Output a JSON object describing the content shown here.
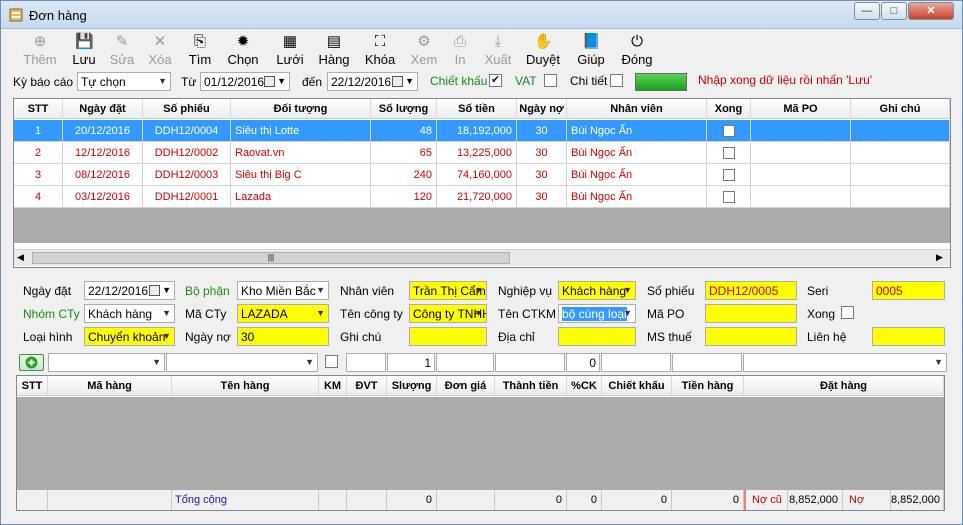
{
  "window": {
    "title": "Đơn hàng",
    "min": "—",
    "max": "□",
    "close": "✕"
  },
  "toolbar": [
    {
      "label": "Thêm",
      "icon": "add-icon",
      "glyph": "⊕",
      "disabled": true
    },
    {
      "label": "Lưu",
      "icon": "save-icon",
      "glyph": "💾",
      "disabled": false
    },
    {
      "label": "Sửa",
      "icon": "edit-icon",
      "glyph": "✎",
      "disabled": true
    },
    {
      "label": "Xóa",
      "icon": "delete-icon",
      "glyph": "✕",
      "disabled": true
    },
    {
      "label": "Tìm",
      "icon": "find-icon",
      "glyph": "⎘",
      "disabled": false
    },
    {
      "label": "Chọn",
      "icon": "select-icon",
      "glyph": "✹",
      "disabled": false
    },
    {
      "label": "Lưới",
      "icon": "grid-icon",
      "glyph": "▦",
      "disabled": false
    },
    {
      "label": "Hàng",
      "icon": "goods-icon",
      "glyph": "▤",
      "disabled": false
    },
    {
      "label": "Khóa",
      "icon": "lock-icon",
      "glyph": "⛶",
      "disabled": false
    },
    {
      "label": "Xem",
      "icon": "view-icon",
      "glyph": "⚙",
      "disabled": true
    },
    {
      "label": "In",
      "icon": "print-icon",
      "glyph": "⎙",
      "disabled": true
    },
    {
      "label": "Xuất",
      "icon": "export-icon",
      "glyph": "⤓",
      "disabled": true
    },
    {
      "label": "Duyệt",
      "icon": "approve-icon",
      "glyph": "✋",
      "disabled": false
    },
    {
      "label": "Giúp",
      "icon": "help-icon",
      "glyph": "📘",
      "disabled": false
    },
    {
      "label": "Đóng",
      "icon": "power-icon",
      "glyph": "⏻",
      "disabled": false
    }
  ],
  "filter": {
    "period_label": "Kỳ báo cáo",
    "period_value": "Tự chọn",
    "from_label": "Từ",
    "from_value": "01/12/2016",
    "to_label": "đến",
    "to_value": "22/12/2016",
    "discount_label": "Chiết khấu",
    "discount_checked": "✔",
    "vat_label": "VAT",
    "detail_label": "Chi tiết",
    "message": "Nhập xong dữ liệu rồi nhấn 'Lưu'"
  },
  "orders": {
    "columns": [
      "STT",
      "Ngày đặt",
      "Số phiếu",
      "Đối tượng",
      "Số lượng",
      "Số tiền",
      "Ngày nợ",
      "Nhân viên",
      "Xong",
      "Mã PO",
      "Ghi chú"
    ],
    "rows": [
      {
        "stt": "1",
        "date": "20/12/2016",
        "code": "DDH12/0004",
        "customer": "Siêu thị Lotte",
        "qty": "48",
        "amount": "18,192,000",
        "days": "30",
        "staff": "Bùi Ngọc Ấn"
      },
      {
        "stt": "2",
        "date": "12/12/2016",
        "code": "DDH12/0002",
        "customer": "Raovat.vn",
        "qty": "65",
        "amount": "13,225,000",
        "days": "30",
        "staff": "Bùi Ngọc Ấn"
      },
      {
        "stt": "3",
        "date": "08/12/2016",
        "code": "DDH12/0003",
        "customer": "Siêu thị Big C",
        "qty": "240",
        "amount": "74,160,000",
        "days": "30",
        "staff": "Bùi Ngọc Ấn"
      },
      {
        "stt": "4",
        "date": "03/12/2016",
        "code": "DDH12/0001",
        "customer": "Lazada",
        "qty": "120",
        "amount": "21,720,000",
        "days": "30",
        "staff": "Bùi Ngọc Ấn"
      }
    ],
    "scroll_grip": "|||"
  },
  "form": {
    "order_date_label": "Ngày đặt",
    "order_date": "22/12/2016",
    "dept_label": "Bộ phận",
    "dept": "Kho Miền Bắc",
    "staff_label": "Nhân viên",
    "staff": "Trần Thị Cẩm",
    "op_label": "Nghiệp vụ",
    "op": "Khách hàng",
    "voucher_label": "Số phiếu",
    "voucher": "DDH12/0005",
    "seri_label": "Seri",
    "seri": "0005",
    "group_label": "Nhóm CTy",
    "group": "Khách hàng",
    "code_label": "Mã CTy",
    "code": "LAZADA",
    "company_label": "Tên công ty",
    "company": "Công ty TNHH",
    "promo_label": "Tên CTKM",
    "promo": "bộ cùng loại",
    "po_label": "Mã PO",
    "done_label": "Xong",
    "type_label": "Loại hình",
    "type": "Chuyển khoản",
    "debt_label": "Ngày nợ",
    "debt": "30",
    "note_label": "Ghi chú",
    "addr_label": "Địa chỉ",
    "tax_label": "MS thuế",
    "contact_label": "Liên hệ"
  },
  "entry": {
    "qty": "1",
    "price": "0"
  },
  "items": {
    "columns": [
      "STT",
      "Mã hàng",
      "Tên hàng",
      "KM",
      "ĐVT",
      "Slượng",
      "Đơn giá",
      "Thành tiền",
      "%CK",
      "Chiết khấu",
      "Tiền hàng",
      "Đặt hàng"
    ],
    "total_label": "Tổng cộng",
    "tot_qty": "0",
    "tot_amount": "0",
    "tot_pct": "0",
    "tot_disc": "0",
    "tot_goods": "0",
    "old_debt_label": "Nợ cũ",
    "old_debt": "8,852,000",
    "new_debt_label": "Nợ mới",
    "new_debt": "8,852,000"
  },
  "colors": {
    "selection": "#3399ff",
    "highlight": "#ffff00",
    "red": "#cc0000",
    "green": "#168a16"
  }
}
